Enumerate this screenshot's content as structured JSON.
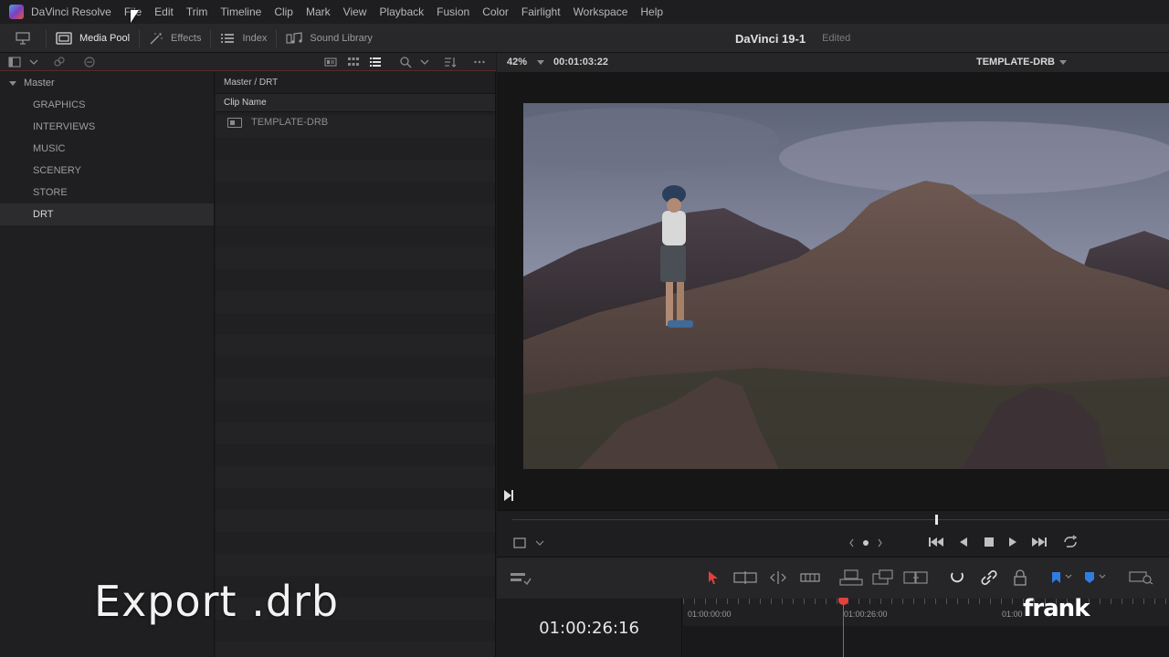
{
  "menubar": {
    "app": "DaVinci Resolve",
    "items": [
      "File",
      "Edit",
      "Trim",
      "Timeline",
      "Clip",
      "Mark",
      "View",
      "Playback",
      "Fusion",
      "Color",
      "Fairlight",
      "Workspace",
      "Help"
    ]
  },
  "toolbar": {
    "media_pool": "Media Pool",
    "effects": "Effects",
    "index": "Index",
    "sound_library": "Sound Library"
  },
  "project": {
    "name": "DaVinci 19-1",
    "state": "Edited"
  },
  "bins": {
    "master": "Master",
    "items": [
      "GRAPHICS",
      "INTERVIEWS",
      "MUSIC",
      "SCENERY",
      "STORE",
      "DRT"
    ],
    "selected": "DRT"
  },
  "pool": {
    "path": "Master / DRT",
    "column": "Clip Name",
    "clips": [
      "TEMPLATE-DRB"
    ]
  },
  "viewer": {
    "zoom": "42%",
    "timecode": "00:01:03:22",
    "clip_name": "TEMPLATE-DRB"
  },
  "timeline": {
    "timecode": "01:00:26:16",
    "ruler": [
      "01:00:00:00",
      "01:00:26:00",
      "01:00"
    ]
  },
  "overlay": {
    "title": "Export .drb",
    "watermark": "frank"
  },
  "colors": {
    "playhead": "#e2413c",
    "accent_blue": "#2f7de1"
  }
}
